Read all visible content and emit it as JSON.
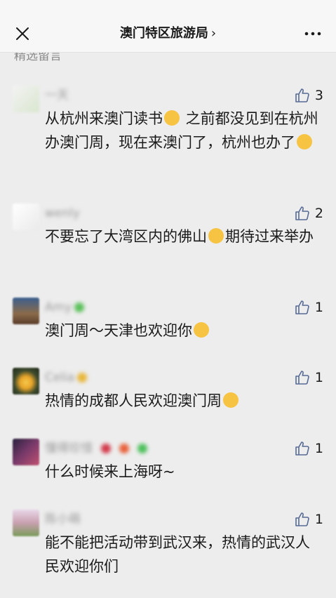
{
  "header": {
    "title": "澳门特区旅游局",
    "chevron": "›"
  },
  "section_label": "精选留言",
  "comments": [
    {
      "name": "一天",
      "likes": "3",
      "text_a": "从杭州来澳门读书",
      "emoji_a": "laughing-tears",
      "text_b": " 之前都没见到在杭州办澳门周，现在来澳门了，杭州也办了",
      "emoji_b": "grin"
    },
    {
      "name": "wenly",
      "likes": "2",
      "text_a": "不要忘了大湾区内的佛山",
      "emoji_a": "wink-kiss",
      "text_b": "期待过来举办"
    },
    {
      "name": "Amy",
      "likes": "1",
      "text_a": "澳门周～天津也欢迎你",
      "emoji_a": "blush-hands"
    },
    {
      "name": "Celia",
      "likes": "1",
      "text_a": "热情的成都人民欢迎澳门周",
      "emoji_a": "smile"
    },
    {
      "name": "懂得珍惜",
      "likes": "1",
      "text_a": "什么时候来上海呀~"
    },
    {
      "name": "陈小萌",
      "likes": "1",
      "text_a": "能不能把活动带到武汉来，热情的武汉人民欢迎你们"
    }
  ],
  "colors": {
    "background": "#ededed",
    "text": "#1a1a1a",
    "muted": "#8a8a8a",
    "like_icon": "#576b95"
  }
}
